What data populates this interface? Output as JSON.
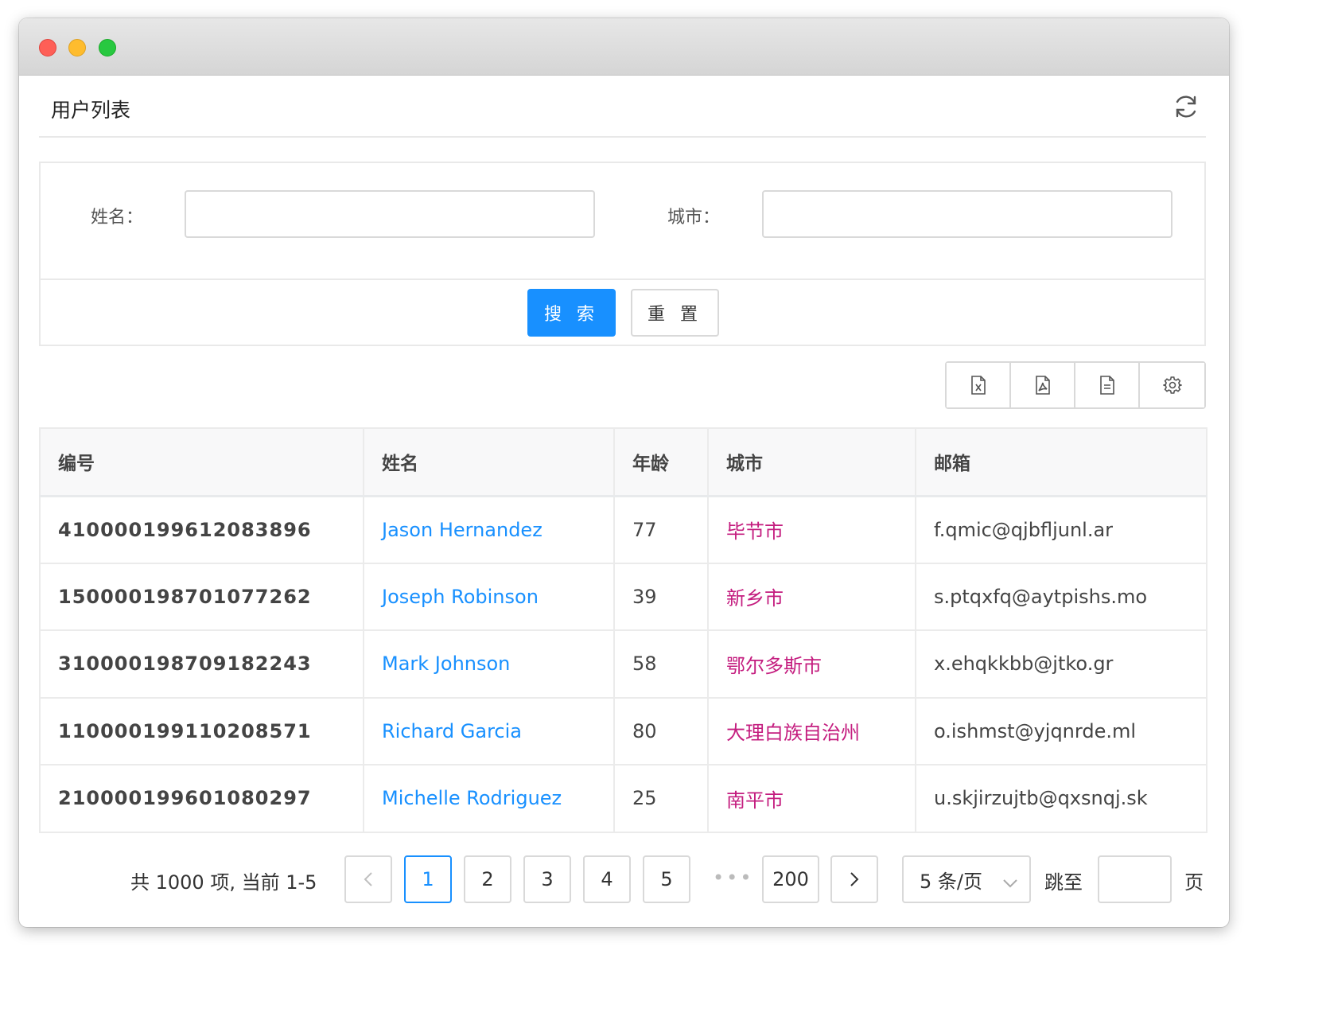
{
  "window": {
    "title": ""
  },
  "header": {
    "title": "用户列表",
    "refresh_icon": "refresh-icon"
  },
  "search": {
    "name_label": "姓名：",
    "name_value": "",
    "city_label": "城市：",
    "city_value": "",
    "search_button": "搜 索",
    "reset_button": "重 置"
  },
  "toolbar": {
    "icons": [
      "excel-export-icon",
      "pdf-export-icon",
      "csv-export-icon",
      "settings-icon"
    ]
  },
  "table": {
    "columns": [
      "编号",
      "姓名",
      "年龄",
      "城市",
      "邮箱"
    ],
    "rows": [
      {
        "id": "410000199612083896",
        "name": "Jason Hernandez",
        "age": "77",
        "city": "毕节市",
        "email": "f.qmic@qjbfljunl.ar"
      },
      {
        "id": "150000198701077262",
        "name": "Joseph Robinson",
        "age": "39",
        "city": "新乡市",
        "email": "s.ptqxfq@aytpishs.mo"
      },
      {
        "id": "310000198709182243",
        "name": "Mark Johnson",
        "age": "58",
        "city": "鄂尔多斯市",
        "email": "x.ehqkkbb@jtko.gr"
      },
      {
        "id": "110000199110208571",
        "name": "Richard Garcia",
        "age": "80",
        "city": "大理白族自治州",
        "email": "o.ishmst@yjqnrde.ml"
      },
      {
        "id": "210000199601080297",
        "name": "Michelle Rodriguez",
        "age": "25",
        "city": "南平市",
        "email": "u.skjirzujtb@qxsnqj.sk"
      }
    ]
  },
  "pagination": {
    "total_text": "共 1000 项, 当前 1-5",
    "prev": "<",
    "next": ">",
    "pages": [
      "1",
      "2",
      "3",
      "4",
      "5"
    ],
    "ellipsis": "•••",
    "last_page": "200",
    "current_page": "1",
    "page_size": "5 条/页",
    "jump_label": "跳至",
    "jump_value": "",
    "page_suffix": "页"
  },
  "colors": {
    "primary": "#1890ff",
    "city_text": "#c41d7f",
    "border": "#d9d9d9"
  }
}
